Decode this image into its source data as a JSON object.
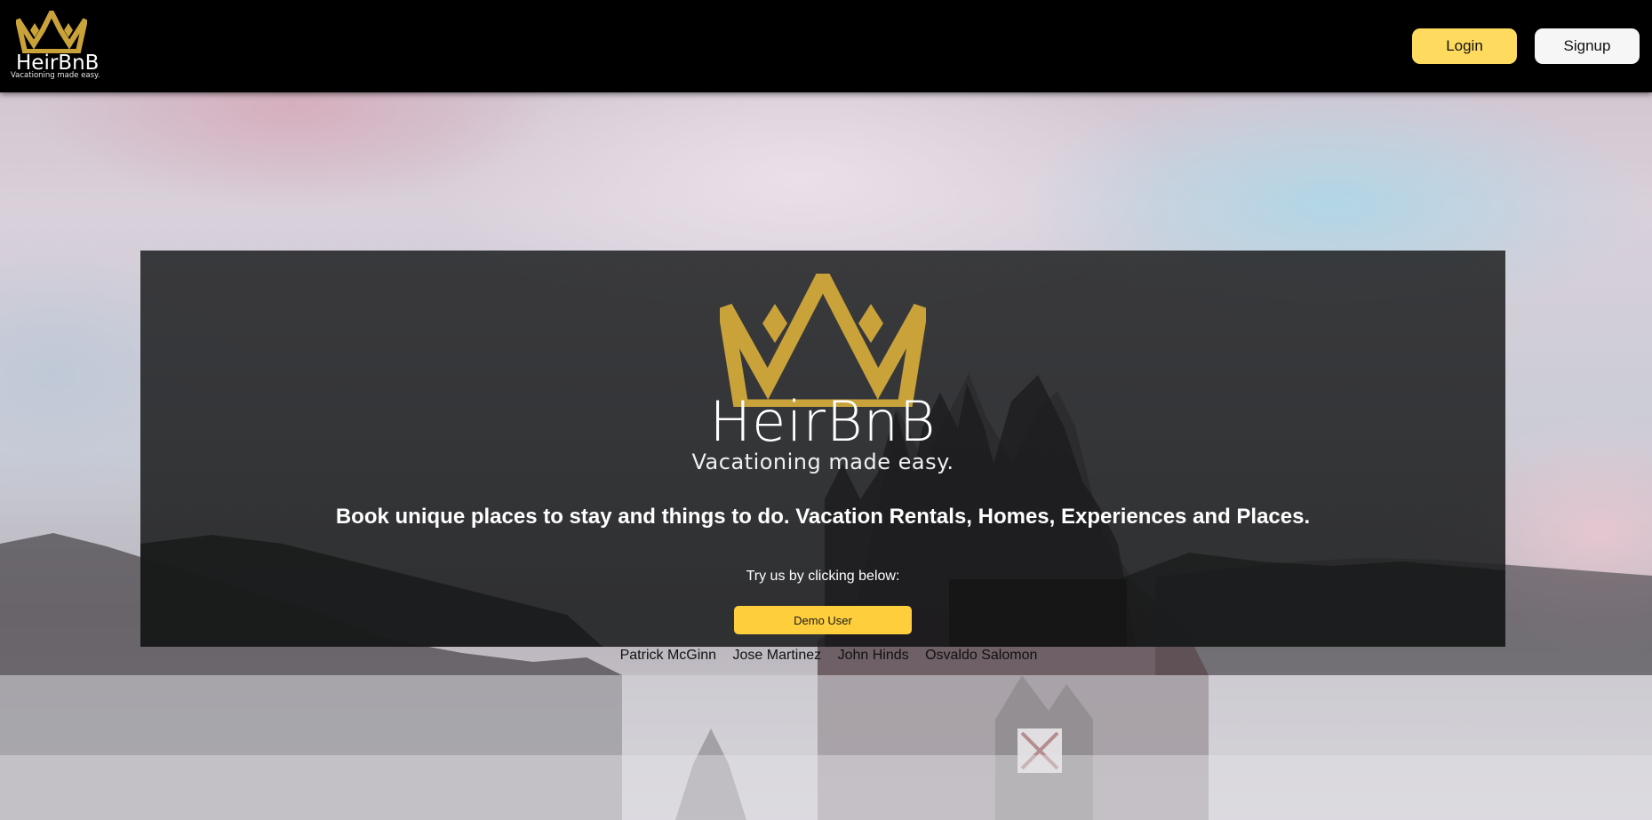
{
  "colors": {
    "brand_gold": "#c9a23a",
    "button_yellow": "#fedb5f",
    "demo_yellow": "#ffce3d",
    "nav_bg": "#000000"
  },
  "header": {
    "logo_icon": "crown-icon",
    "logo_word": "HeirBnB",
    "logo_tag": "Vacationing made easy.",
    "login_label": "Login",
    "signup_label": "Signup"
  },
  "hero": {
    "logo_icon": "crown-icon",
    "logo_word": "HeirBnB",
    "logo_tag": "Vacationing made easy.",
    "headline": "Book unique places to stay and things to do. Vacation Rentals, Homes, Experiences and Places.",
    "try_text": "Try us by clicking below:",
    "demo_label": "Demo User"
  },
  "credits": {
    "people": [
      "Patrick McGinn",
      "Jose Martinez",
      "John Hinds",
      "Osvaldo Salomon"
    ]
  }
}
